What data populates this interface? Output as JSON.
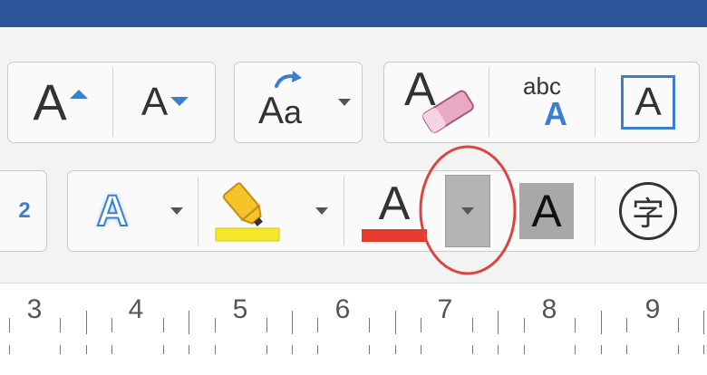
{
  "toolbar": {
    "row1": {
      "grow_font_glyph": "A",
      "shrink_font_glyph": "A",
      "change_case_glyph_big": "A",
      "change_case_glyph_small": "a",
      "clear_formatting_glyph": "A",
      "phonetic_guide_top": "abc",
      "phonetic_guide_bottom": "A",
      "character_border_glyph": "A"
    },
    "row2": {
      "partial_number_label": "2",
      "text_effects_glyph": "A",
      "font_color_glyph": "A",
      "character_shading_glyph": "A",
      "enclose_characters_glyph": "字"
    },
    "colors": {
      "title_bar": "#2b579a",
      "accent_blue": "#3b7fd0",
      "highlight_yellow": "#f5e72a",
      "font_color_red": "#e53b2c",
      "annotation_circle": "#d9463f",
      "shading_gray": "#a8a8a8"
    }
  },
  "ruler": {
    "numbers": [
      "3",
      "4",
      "5",
      "6",
      "7",
      "8",
      "9"
    ]
  }
}
